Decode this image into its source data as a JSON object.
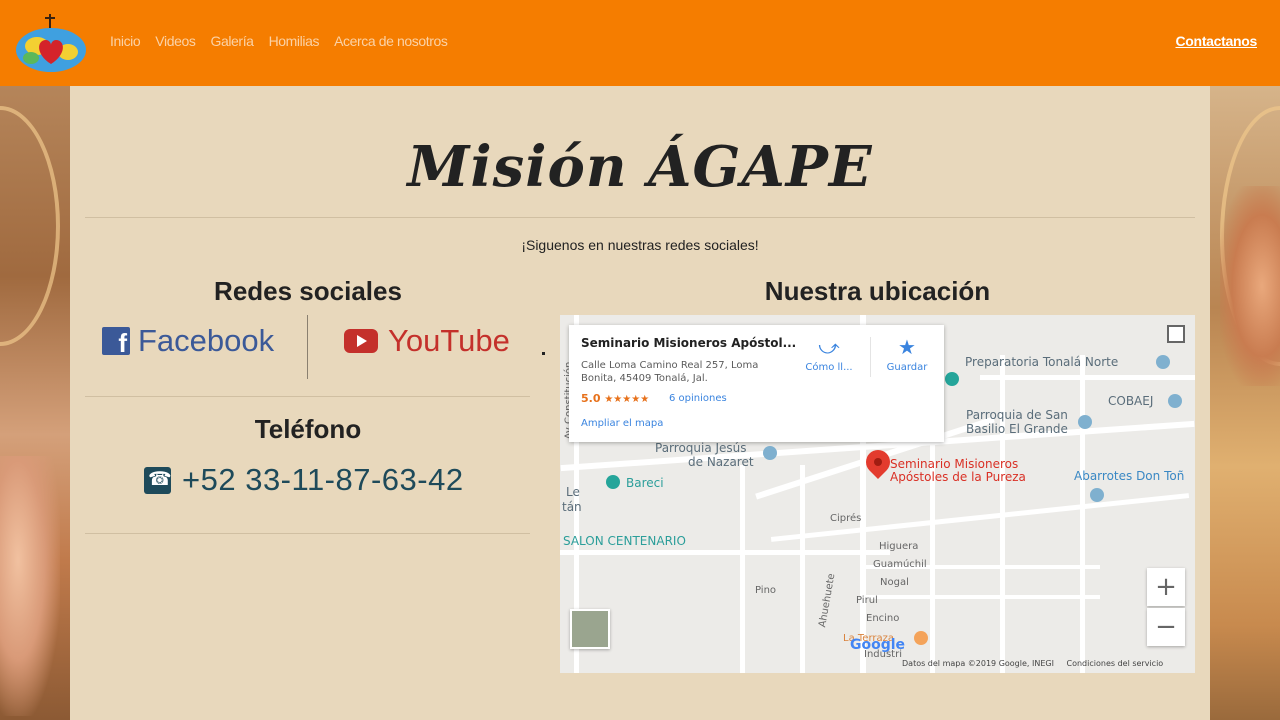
{
  "nav": {
    "logo_name": "mission-globe-logo",
    "links": [
      "Inicio",
      "Videos",
      "Galería",
      "Homilias",
      "Acerca de nosotros"
    ],
    "contact": "Contactanos"
  },
  "main": {
    "title": "Misión ÁGAPE",
    "subtitle": "¡Siguenos en nuestras redes sociales!",
    "social_heading": "Redes sociales",
    "facebook_label": "Facebook",
    "youtube_label": "YouTube",
    "phone_heading": "Teléfono",
    "phone_number": "+52 33-11-87-63-42",
    "location_heading": "Nuestra ubicación"
  },
  "map": {
    "place_name": "Seminario Misioneros Apóstol...",
    "address": "Calle Loma Camino Real 257, Loma Bonita, 45409 Tonalá, Jal.",
    "rating": "5.0",
    "stars": "★★★★★",
    "reviews": "6 opiniones",
    "enlarge": "Ampliar el mapa",
    "directions": "Cómo ll...",
    "save": "Guardar",
    "pin_label_1": "Seminario Misioneros",
    "pin_label_2": "Apóstoles de la Pureza",
    "labels": {
      "prep": "Preparatoria Tonalá Norte",
      "cobaej": "COBAEJ",
      "parroquia_sb_1": "Parroquia de San",
      "parroquia_sb_2": "Basilio El Grande",
      "parroquia_jn_1": "Parroquia Jesús",
      "parroquia_jn_2": "de Nazaret",
      "bareci": "Bareci",
      "abarrotes": "Abarrotes Don Toñ",
      "salon": "SALON CENTENARIO",
      "le": "Le",
      "tan": "tán",
      "av_const": "Av Constitución",
      "higuera": "Higuera",
      "guamuchil": "Guamúchil",
      "nogal": "Nogal",
      "pirul": "Pirul",
      "pino": "Pino",
      "cipres": "Ciprés",
      "encino": "Encino",
      "ahuehuete": "Ahuehuete",
      "la_terraza": "La Terraza",
      "industri": "Industri"
    },
    "google": "Google",
    "footer_data": "Datos del mapa ©2019 Google, INEGI",
    "footer_terms": "Condiciones del servicio"
  },
  "colors": {
    "navbar": "#f57d00",
    "panel": "#e8d8bc",
    "facebook": "#3b5998",
    "youtube": "#c4302b",
    "phone": "#1e4a5a"
  }
}
